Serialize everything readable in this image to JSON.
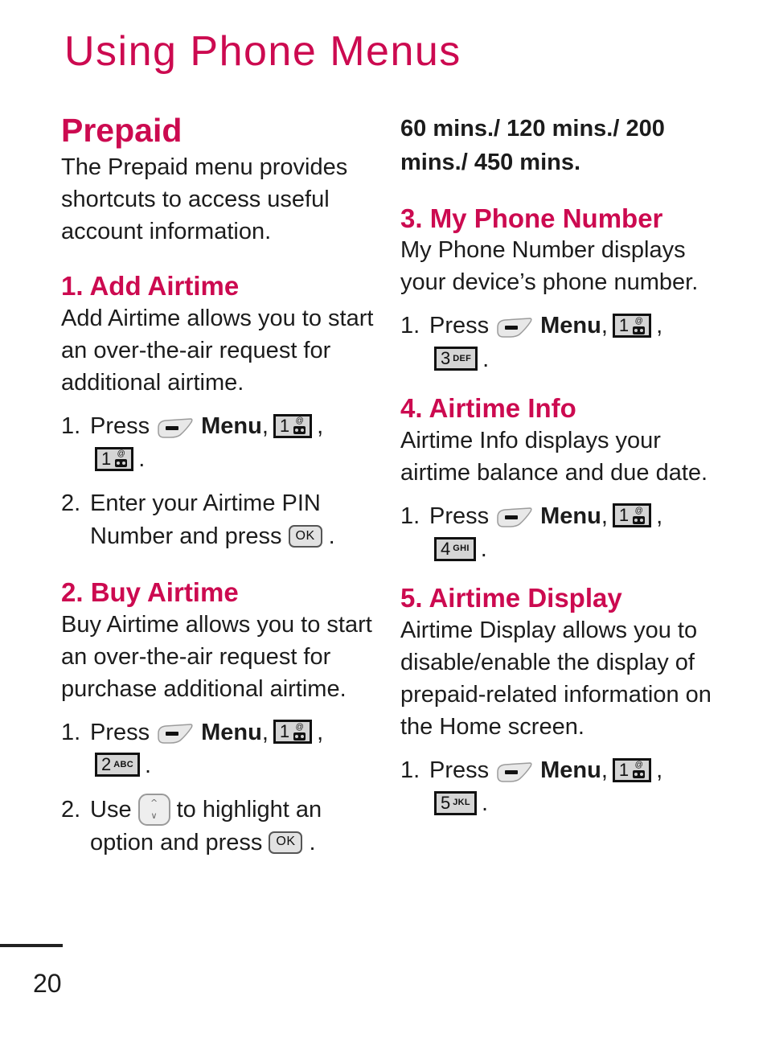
{
  "chapter": {
    "title": "Using Phone Menus"
  },
  "colors": {
    "accent": "#cc0a50",
    "body_text": "#1c1c1c",
    "keycap_fill": "#d5d5d5",
    "keycap_border": "#111111"
  },
  "left_column": {
    "prepaid": {
      "heading": "Prepaid",
      "paragraph": "The Prepaid menu provides shortcuts to access useful account information."
    },
    "add_airtime": {
      "heading": "1. Add Airtime",
      "paragraph": "Add Airtime allows you to start an over-the-air request for additional airtime.",
      "steps": [
        {
          "number": "1.",
          "prefix": "Press",
          "softkey": "left-soft-key",
          "menu_label": "Menu",
          "comma": ",",
          "key1": {
            "digit": "1",
            "sub": "voicemail"
          },
          "comma2": ",",
          "key2": {
            "digit": "1",
            "sub": "voicemail"
          },
          "period": "."
        },
        {
          "number": "2.",
          "line1": "Enter your Airtime PIN",
          "line2_prefix": "Number and press",
          "ok_label": "OK",
          "period": "."
        }
      ]
    },
    "buy_airtime": {
      "heading": "2. Buy Airtime",
      "paragraph": "Buy Airtime allows you to start an over-the-air request for purchase additional airtime.",
      "steps": [
        {
          "number": "1.",
          "prefix": "Press",
          "softkey": "left-soft-key",
          "menu_label": "Menu",
          "comma": ",",
          "key1": {
            "digit": "1",
            "sub": "voicemail"
          },
          "comma2": ",",
          "key2": {
            "digit": "2",
            "letters": "ABC"
          },
          "period": "."
        },
        {
          "number": "2.",
          "prefix": "Use",
          "navkey": "up-down-navigation-key",
          "suffix": "to highlight an",
          "line2_prefix": "option and press",
          "ok_label": "OK",
          "period": "."
        }
      ]
    }
  },
  "right_column": {
    "airtime_options": {
      "text": "60 mins./ 120 mins./ 200 mins./ 450 mins."
    },
    "my_phone_number": {
      "heading": "3. My Phone Number",
      "paragraph": "My Phone Number displays your device’s phone number.",
      "steps": [
        {
          "number": "1.",
          "prefix": "Press",
          "softkey": "left-soft-key",
          "menu_label": "Menu",
          "comma": ",",
          "key1": {
            "digit": "1",
            "sub": "voicemail"
          },
          "comma2": ",",
          "key2": {
            "digit": "3",
            "letters": "DEF"
          },
          "period": "."
        }
      ]
    },
    "airtime_info": {
      "heading": "4. Airtime Info",
      "paragraph": "Airtime Info displays your airtime balance and due date.",
      "steps": [
        {
          "number": "1.",
          "prefix": "Press",
          "softkey": "left-soft-key",
          "menu_label": "Menu",
          "comma": ",",
          "key1": {
            "digit": "1",
            "sub": "voicemail"
          },
          "comma2": ",",
          "key2": {
            "digit": "4",
            "letters": "GHI"
          },
          "period": "."
        }
      ]
    },
    "airtime_display": {
      "heading": "5. Airtime Display",
      "paragraph": "Airtime Display allows you to disable/enable the display of prepaid-related information on the Home screen.",
      "steps": [
        {
          "number": "1.",
          "prefix": "Press",
          "softkey": "left-soft-key",
          "menu_label": "Menu",
          "comma": ",",
          "key1": {
            "digit": "1",
            "sub": "voicemail"
          },
          "comma2": ",",
          "key2": {
            "digit": "5",
            "letters": "JKL"
          },
          "period": "."
        }
      ]
    }
  },
  "footer": {
    "page_number": "20"
  }
}
